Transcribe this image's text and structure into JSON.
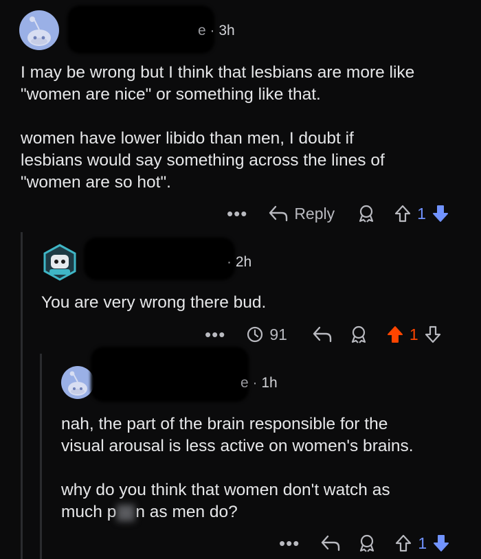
{
  "comments": [
    {
      "time": "3h",
      "username_suffix": "e",
      "paragraphs": [
        "I may be wrong but I think that lesbians are more like\n\"women are nice\" or something like that.",
        "women have lower libido than men, I doubt if\nlesbians would say something across the lines of\n\"women are so hot\"."
      ],
      "actions": {
        "more": "•••",
        "reply_label": "Reply",
        "vote_count": "1"
      }
    },
    {
      "time": "2h",
      "username_suffix": "",
      "paragraphs": [
        "You are very wrong there bud."
      ],
      "actions": {
        "more": "•••",
        "views": "91",
        "vote_count": "1"
      }
    },
    {
      "time": "1h",
      "username_suffix": "e",
      "paragraphs": [
        "nah, the part of the brain responsible for the\nvisual arousal is less active on women's brains.",
        "why do you think that women don't watch as\nmuch p"
      ],
      "censored_tail": "n as men do?",
      "actions": {
        "more": "•••",
        "vote_count": "1"
      }
    }
  ],
  "colors": {
    "upvote_active": "#ff4500",
    "downvote_active": "#7193ff",
    "avatar_bg": "#9ab0e6"
  }
}
